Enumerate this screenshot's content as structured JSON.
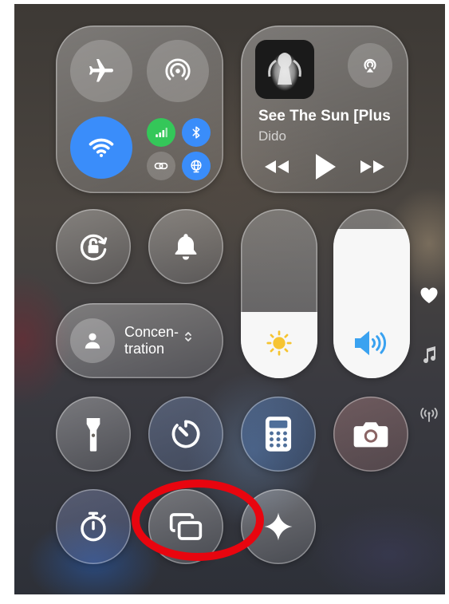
{
  "now_playing": {
    "title": "See The Sun [Plus",
    "artist": "Dido"
  },
  "focus": {
    "label_line1": "Concen-",
    "label_line2": "tration"
  },
  "sliders": {
    "brightness_level": 0.39,
    "volume_level": 0.88
  },
  "colors": {
    "wifi_active": "#3a8dfa",
    "bluetooth_active": "#3a8dfa",
    "cellular_active": "#34c759",
    "vpn_active": "#3a8dfa",
    "brightness_icon": "#f6c431",
    "volume_icon": "#3aa2f0",
    "annotation_ring": "#e8050f"
  },
  "icons": {
    "airplane": "airplane-icon",
    "airdrop": "airdrop-icon",
    "wifi": "wifi-icon",
    "cellular": "cellular-icon",
    "bluetooth": "bluetooth-icon",
    "link": "link-icon",
    "vpn": "globe-icon",
    "airplay": "airplay-icon",
    "rewind": "rewind-icon",
    "play": "play-icon",
    "fast_forward": "fast-forward-icon",
    "rotation_lock": "rotation-lock-icon",
    "silent_mode": "bell-icon",
    "focus": "person-icon",
    "focus_chevron": "chevron-updown-icon",
    "brightness": "sun-icon",
    "volume": "speaker-icon",
    "flashlight": "flashlight-icon",
    "timer": "timer-icon",
    "calculator": "calculator-icon",
    "camera": "camera-icon",
    "stopwatch": "stopwatch-icon",
    "screen_mirroring": "screen-mirroring-icon",
    "ai": "sparkle-icon",
    "page_favorites": "heart-icon",
    "page_music": "music-note-icon",
    "page_connectivity": "antenna-icon"
  }
}
